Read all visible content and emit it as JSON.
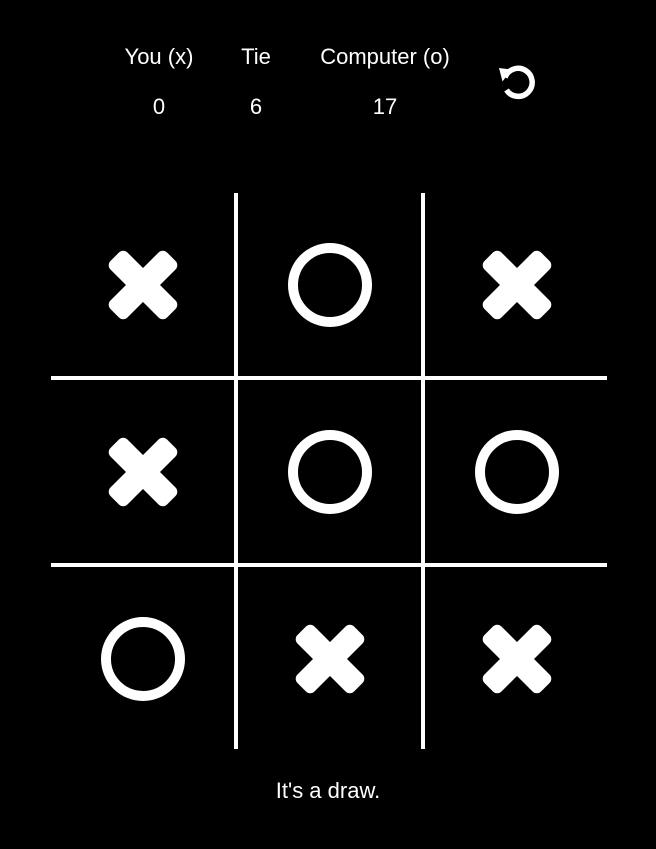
{
  "scoreboard": {
    "you": {
      "label": "You (x)",
      "value": "0"
    },
    "tie": {
      "label": "Tie",
      "value": "6"
    },
    "computer": {
      "label": "Computer (o)",
      "value": "17"
    }
  },
  "restart_icon": "restart-icon",
  "board": {
    "cells": [
      "x",
      "o",
      "x",
      "x",
      "o",
      "o",
      "o",
      "x",
      "x"
    ]
  },
  "status": "It's a draw.",
  "colors": {
    "background": "#000000",
    "foreground": "#ffffff"
  }
}
